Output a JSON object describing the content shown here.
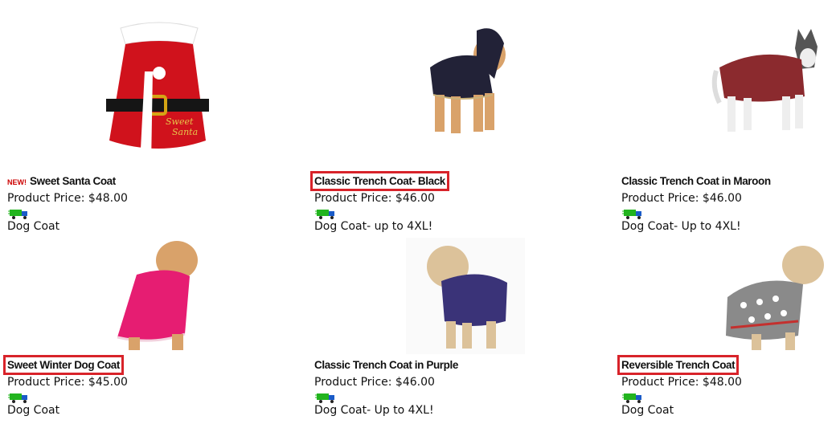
{
  "products": [
    {
      "badge": "NEW!",
      "title": "Sweet Santa Coat",
      "price": "Product Price: $48.00",
      "desc": "Dog Coat",
      "shipping_icon": "truck-icon",
      "highlighted": false
    },
    {
      "badge": "",
      "title": "Classic Trench Coat- Black",
      "price": "Product Price: $46.00",
      "desc": "Dog Coat- up to 4XL!",
      "shipping_icon": "truck-icon",
      "highlighted": true
    },
    {
      "badge": "",
      "title": "Classic Trench Coat in Maroon",
      "price": "Product Price: $46.00",
      "desc": "Dog Coat- Up to 4XL!",
      "shipping_icon": "truck-icon",
      "highlighted": false
    },
    {
      "badge": "",
      "title": "Sweet Winter Dog Coat",
      "price": "Product Price: $45.00",
      "desc": "Dog Coat",
      "shipping_icon": "truck-icon",
      "highlighted": true
    },
    {
      "badge": "",
      "title": "Classic Trench Coat in Purple",
      "price": "Product Price: $46.00",
      "desc": "Dog Coat- Up to 4XL!",
      "shipping_icon": "truck-icon",
      "highlighted": false
    },
    {
      "badge": "",
      "title": "Reversible Trench Coat",
      "price": "Product Price: $48.00",
      "desc": "Dog Coat",
      "shipping_icon": "truck-icon",
      "highlighted": true
    }
  ],
  "colors": {
    "highlight": "#d8232a",
    "badge": "#cc0000",
    "truck": "#22b41e"
  }
}
